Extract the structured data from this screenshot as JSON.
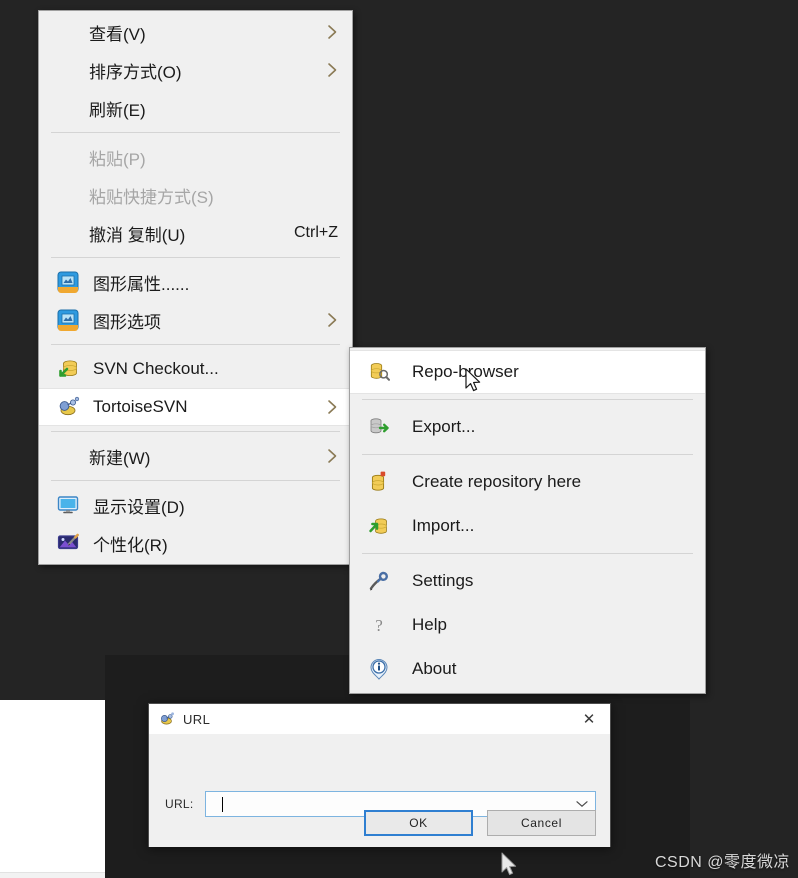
{
  "colors": {
    "desktop_background": "#242424",
    "panel_inset": "#1d1d1d",
    "menu_background": "#f0f0f0",
    "menu_hover": "#ffffff",
    "menu_text": "#1b1b1b",
    "menu_text_disabled": "#a6a6a6",
    "dialog_background": "#f0f0f0",
    "dialog_titlebar": "#ffffff",
    "focus_blue": "#2f7fd1",
    "combo_border": "#7db4e0"
  },
  "context_menu": {
    "name": "desktop-context-menu",
    "items": [
      {
        "label": "查看(V)",
        "icon": "none",
        "submenu": true,
        "disabled": false,
        "accel": ""
      },
      {
        "label": "排序方式(O)",
        "icon": "none",
        "submenu": true,
        "disabled": false,
        "accel": ""
      },
      {
        "label": "刷新(E)",
        "icon": "none",
        "submenu": false,
        "disabled": false,
        "accel": ""
      },
      {
        "separator": true
      },
      {
        "label": "粘贴(P)",
        "icon": "none",
        "submenu": false,
        "disabled": true,
        "accel": ""
      },
      {
        "label": "粘贴快捷方式(S)",
        "icon": "none",
        "submenu": false,
        "disabled": true,
        "accel": ""
      },
      {
        "label": "撤消 复制(U)",
        "icon": "none",
        "submenu": false,
        "disabled": false,
        "accel": "Ctrl+Z"
      },
      {
        "separator": true
      },
      {
        "label": "图形属性......",
        "icon": "graphics-properties-icon",
        "submenu": false,
        "disabled": false,
        "accel": ""
      },
      {
        "label": "图形选项",
        "icon": "graphics-options-icon",
        "submenu": true,
        "disabled": false,
        "accel": ""
      },
      {
        "separator": true
      },
      {
        "label": "SVN Checkout...",
        "icon": "svn-checkout-icon",
        "submenu": false,
        "disabled": false,
        "accel": ""
      },
      {
        "label": "TortoiseSVN",
        "icon": "tortoisesvn-icon",
        "submenu": true,
        "disabled": false,
        "accel": "",
        "hover": true
      },
      {
        "separator": true
      },
      {
        "label": "新建(W)",
        "icon": "none",
        "submenu": true,
        "disabled": false,
        "accel": ""
      },
      {
        "separator": true
      },
      {
        "label": "显示设置(D)",
        "icon": "display-settings-icon",
        "submenu": false,
        "disabled": false,
        "accel": ""
      },
      {
        "label": "个性化(R)",
        "icon": "personalize-icon",
        "submenu": false,
        "disabled": false,
        "accel": ""
      }
    ]
  },
  "submenu": {
    "name": "tortoisesvn-submenu",
    "parent": "TortoiseSVN",
    "items": [
      {
        "label": "Repo-browser",
        "icon": "repo-browser-icon",
        "hover": true
      },
      {
        "separator": true
      },
      {
        "label": "Export...",
        "icon": "export-icon"
      },
      {
        "separator": true
      },
      {
        "label": "Create repository here",
        "icon": "create-repository-icon"
      },
      {
        "label": "Import...",
        "icon": "import-icon"
      },
      {
        "separator": true
      },
      {
        "label": "Settings",
        "icon": "settings-icon"
      },
      {
        "label": "Help",
        "icon": "help-icon"
      },
      {
        "label": "About",
        "icon": "about-icon"
      }
    ]
  },
  "dialog": {
    "name": "url-dialog",
    "title": "URL",
    "title_icon": "tortoisesvn-icon",
    "close_label": "✕",
    "field_label": "URL:",
    "field_value": "",
    "field_placeholder": "",
    "dropdown_icon": "chevron-down-icon",
    "buttons": [
      {
        "label": "OK",
        "default": true
      },
      {
        "label": "Cancel",
        "default": false
      }
    ]
  },
  "watermark": {
    "text": "CSDN @零度微凉"
  }
}
